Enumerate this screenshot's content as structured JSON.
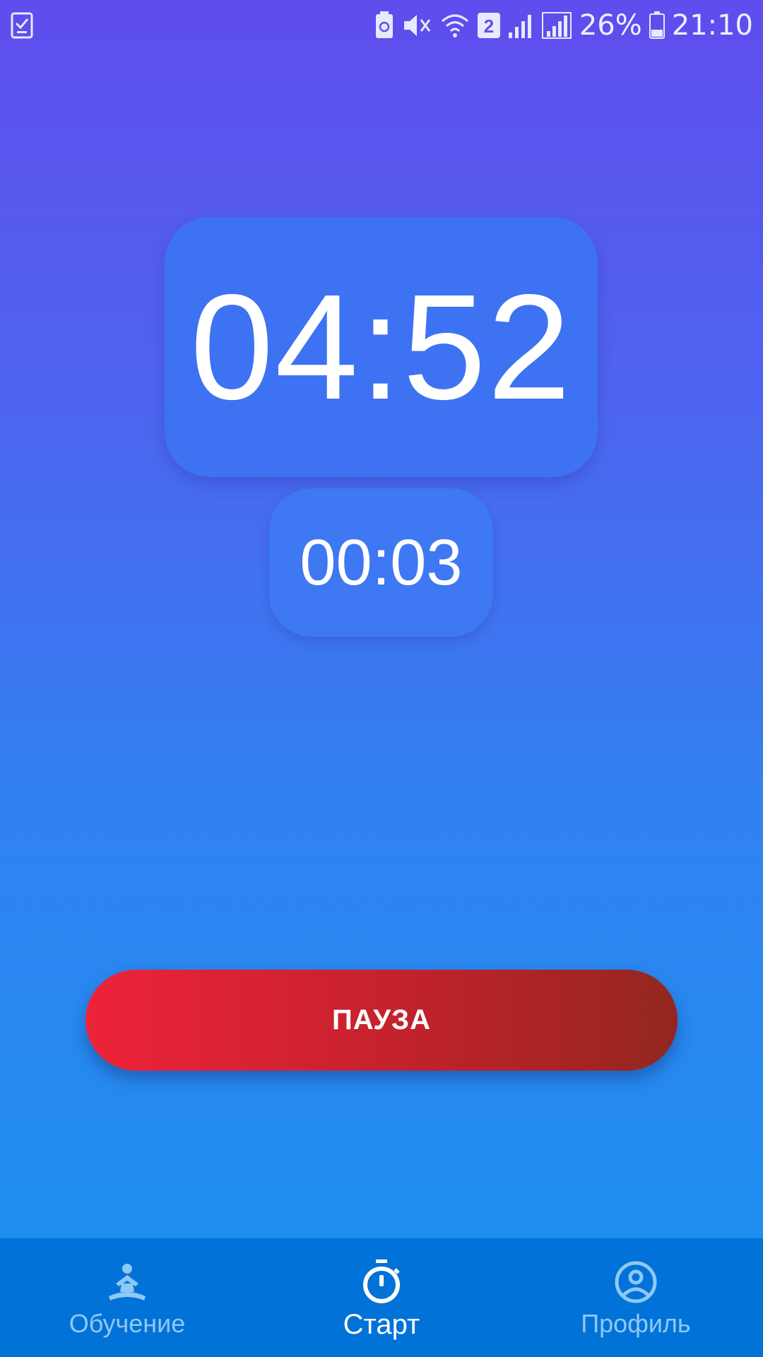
{
  "status_bar": {
    "battery_percent": "26%",
    "time": "21:10",
    "sim_badge": "2",
    "icons": [
      "checklist-icon",
      "battery-saver-icon",
      "mute-icon",
      "wifi-icon",
      "sim-2-icon",
      "signal-icon",
      "signal-icon",
      "battery-icon"
    ]
  },
  "timer": {
    "main": "04:52",
    "secondary": "00:03"
  },
  "actions": {
    "pause_label": "ПАУЗА"
  },
  "nav": {
    "items": [
      {
        "label": "Обучение",
        "icon": "meditation-icon",
        "active": false
      },
      {
        "label": "Старт",
        "icon": "stopwatch-icon",
        "active": true
      },
      {
        "label": "Профиль",
        "icon": "profile-icon",
        "active": false
      }
    ]
  },
  "colors": {
    "background_top": "#5f4ded",
    "background_bottom": "#1a91ef",
    "timer_card": "#3d72f2",
    "pause_start": "#ee2339",
    "pause_end": "#93261f",
    "nav_background": "#0172d7",
    "nav_inactive": "#8fc8f5",
    "nav_active": "#ffffff"
  }
}
